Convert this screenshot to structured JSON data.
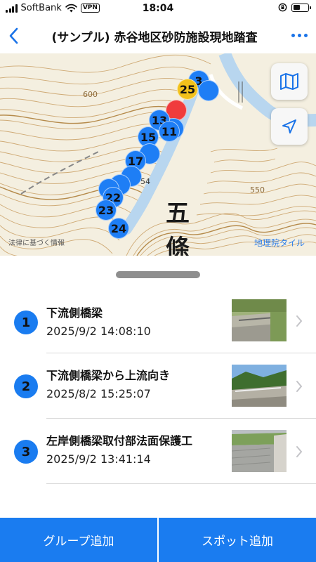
{
  "status_bar": {
    "carrier": "SoftBank",
    "vpn": "VPN",
    "time": "18:04"
  },
  "nav": {
    "title": "(サンプル) 赤谷地区砂防施設現地踏査"
  },
  "map": {
    "place_label_1": "五",
    "place_label_2": "條",
    "contour_label_1": "600",
    "contour_label_2": "550",
    "contour_label_3": "54",
    "credit_left": "法律に基づく情報",
    "credit_right": "地理院タイル",
    "markers": [
      {
        "label": "3",
        "color": "blue"
      },
      {
        "label": "25",
        "color": "yellow"
      },
      {
        "label": "",
        "color": "red"
      },
      {
        "label": "13",
        "color": "blue"
      },
      {
        "label": "11",
        "color": "blue"
      },
      {
        "label": "15",
        "color": "blue"
      },
      {
        "label": "17",
        "color": "blue"
      },
      {
        "label": "22",
        "color": "blue"
      },
      {
        "label": "23",
        "color": "blue"
      },
      {
        "label": "24",
        "color": "blue"
      }
    ]
  },
  "spots": [
    {
      "number": "1",
      "title": "下流側橋梁",
      "date": "2025/9/2 14:08:10"
    },
    {
      "number": "2",
      "title": "下流側橋梁から上流向き",
      "date": "2025/8/2 15:25:07"
    },
    {
      "number": "3",
      "title": "左岸側橋梁取付部法面保護工",
      "date": "2025/9/2 13:41:14"
    }
  ],
  "buttons": {
    "add_group": "グループ追加",
    "add_spot": "スポット追加"
  },
  "colors": {
    "accent": "#1a7cf0",
    "marker_yellow": "#f2c11b",
    "marker_red": "#f03c3c",
    "contour": "#c9a064"
  }
}
